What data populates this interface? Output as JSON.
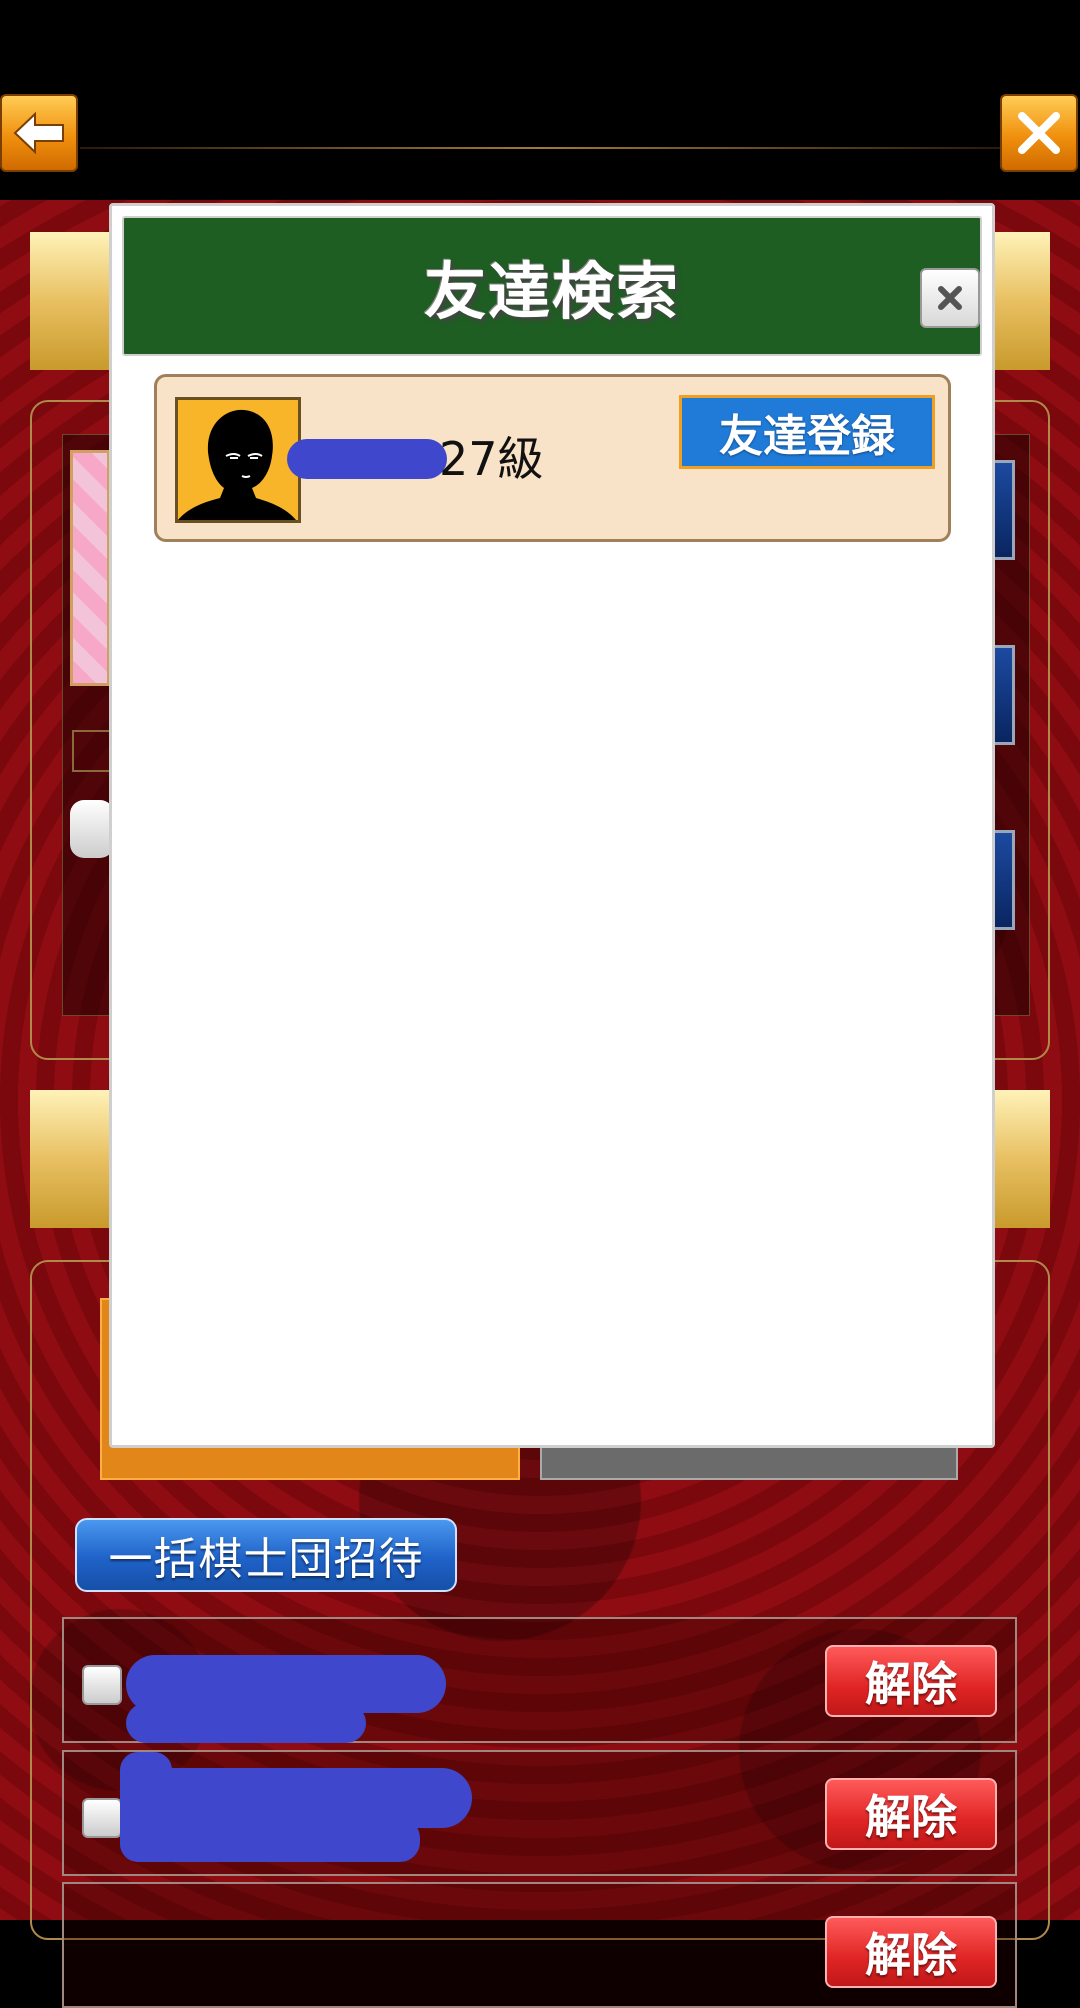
{
  "top_bar": {
    "back_icon": "left-arrow-icon",
    "close_icon": "close-x-icon"
  },
  "background_screen": {
    "invite_button_label": "一括棋士団招待",
    "member_rows": [
      {
        "release_label": "解除"
      },
      {
        "release_label": "解除"
      },
      {
        "release_label": "解除"
      }
    ]
  },
  "modal": {
    "title": "友達検索",
    "close_icon": "close-x-icon",
    "results": [
      {
        "rank": "27級",
        "register_label": "友達登録"
      }
    ]
  },
  "colors": {
    "modal_header": "#1e5e22",
    "register_button": "#1f7ad8",
    "release_button": "#e02424",
    "orange_button": "#f0900e"
  }
}
